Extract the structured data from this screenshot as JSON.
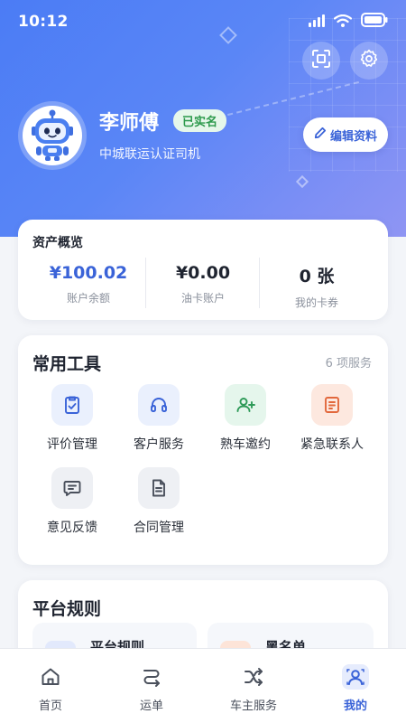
{
  "status_bar": {
    "time": "10:12"
  },
  "profile": {
    "name": "李师傅",
    "badge": "已实名",
    "subtitle": "中城联运认证司机",
    "edit_label": "编辑资料"
  },
  "assets": {
    "title": "资产概览",
    "items": [
      {
        "value": "¥100.02",
        "label": "账户余额"
      },
      {
        "value": "¥0.00",
        "label": "油卡账户"
      },
      {
        "value": "0 张",
        "label": "我的卡券"
      }
    ]
  },
  "tools": {
    "title": "常用工具",
    "meta": "6 项服务",
    "items": [
      {
        "label": "评价管理",
        "icon": "clipboard-check-icon"
      },
      {
        "label": "客户服务",
        "icon": "headset-icon"
      },
      {
        "label": "熟车邀约",
        "icon": "user-plus-icon"
      },
      {
        "label": "紧急联系人",
        "icon": "contact-card-icon"
      },
      {
        "label": "意见反馈",
        "icon": "message-icon"
      },
      {
        "label": "合同管理",
        "icon": "document-icon"
      }
    ]
  },
  "rules": {
    "title": "平台规则",
    "items": [
      {
        "label": "平台规则"
      },
      {
        "label": "黑名单"
      }
    ]
  },
  "tabbar": {
    "items": [
      {
        "label": "首页",
        "icon": "home-icon"
      },
      {
        "label": "运单",
        "icon": "route-icon"
      },
      {
        "label": "车主服务",
        "icon": "shuffle-icon"
      },
      {
        "label": "我的",
        "icon": "user-icon"
      }
    ],
    "active": "我的"
  },
  "colors": {
    "primary": "#3a63d8",
    "header_gradient_start": "#4b7cf5",
    "header_gradient_end": "#8f95f3",
    "badge_bg": "#e6f7ea",
    "badge_text": "#2d9a4c"
  }
}
